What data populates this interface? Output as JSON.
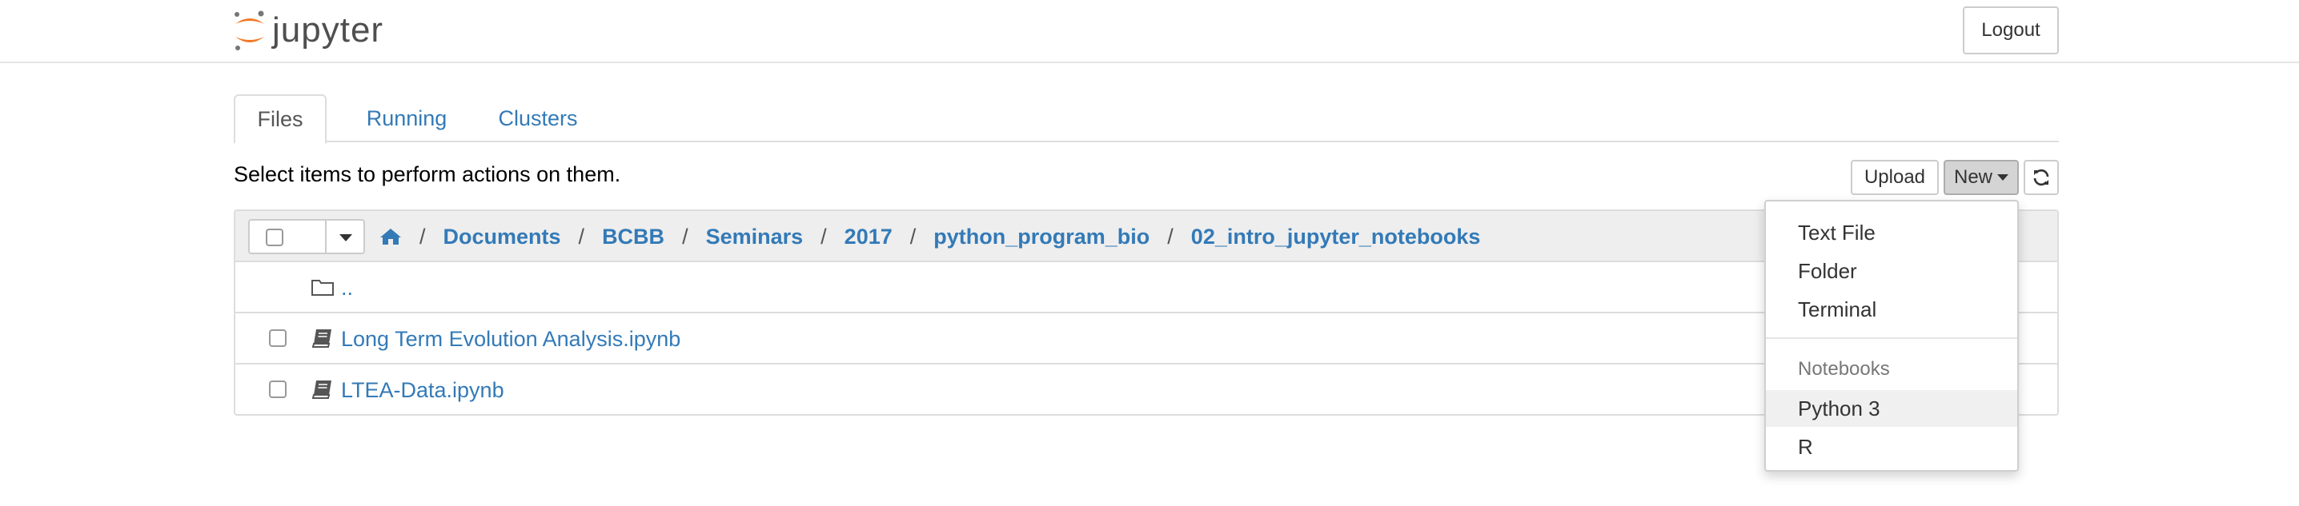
{
  "header": {
    "logo_text": "jupyter",
    "logout_label": "Logout"
  },
  "tabs": [
    {
      "label": "Files",
      "active": true
    },
    {
      "label": "Running",
      "active": false
    },
    {
      "label": "Clusters",
      "active": false
    }
  ],
  "notice": "Select items to perform actions on them.",
  "toolbar": {
    "upload_label": "Upload",
    "new_label": "New",
    "refresh_icon": "refresh-icon"
  },
  "breadcrumb": {
    "home_icon": "home-icon",
    "separator": "/",
    "items": [
      "Documents",
      "BCBB",
      "Seminars",
      "2017",
      "python_program_bio",
      "02_intro_jupyter_notebooks"
    ]
  },
  "files": [
    {
      "name": "..",
      "icon": "folder-icon",
      "checkbox": false
    },
    {
      "name": "Long Term Evolution Analysis.ipynb",
      "icon": "notebook-icon",
      "checkbox": true
    },
    {
      "name": "LTEA-Data.ipynb",
      "icon": "notebook-icon",
      "checkbox": true
    }
  ],
  "new_menu": {
    "items": [
      "Text File",
      "Folder",
      "Terminal"
    ],
    "section_header": "Notebooks",
    "kernels": [
      "Python 3",
      "R"
    ]
  },
  "colors": {
    "link": "#337ab7",
    "logo_orange": "#f37726"
  }
}
